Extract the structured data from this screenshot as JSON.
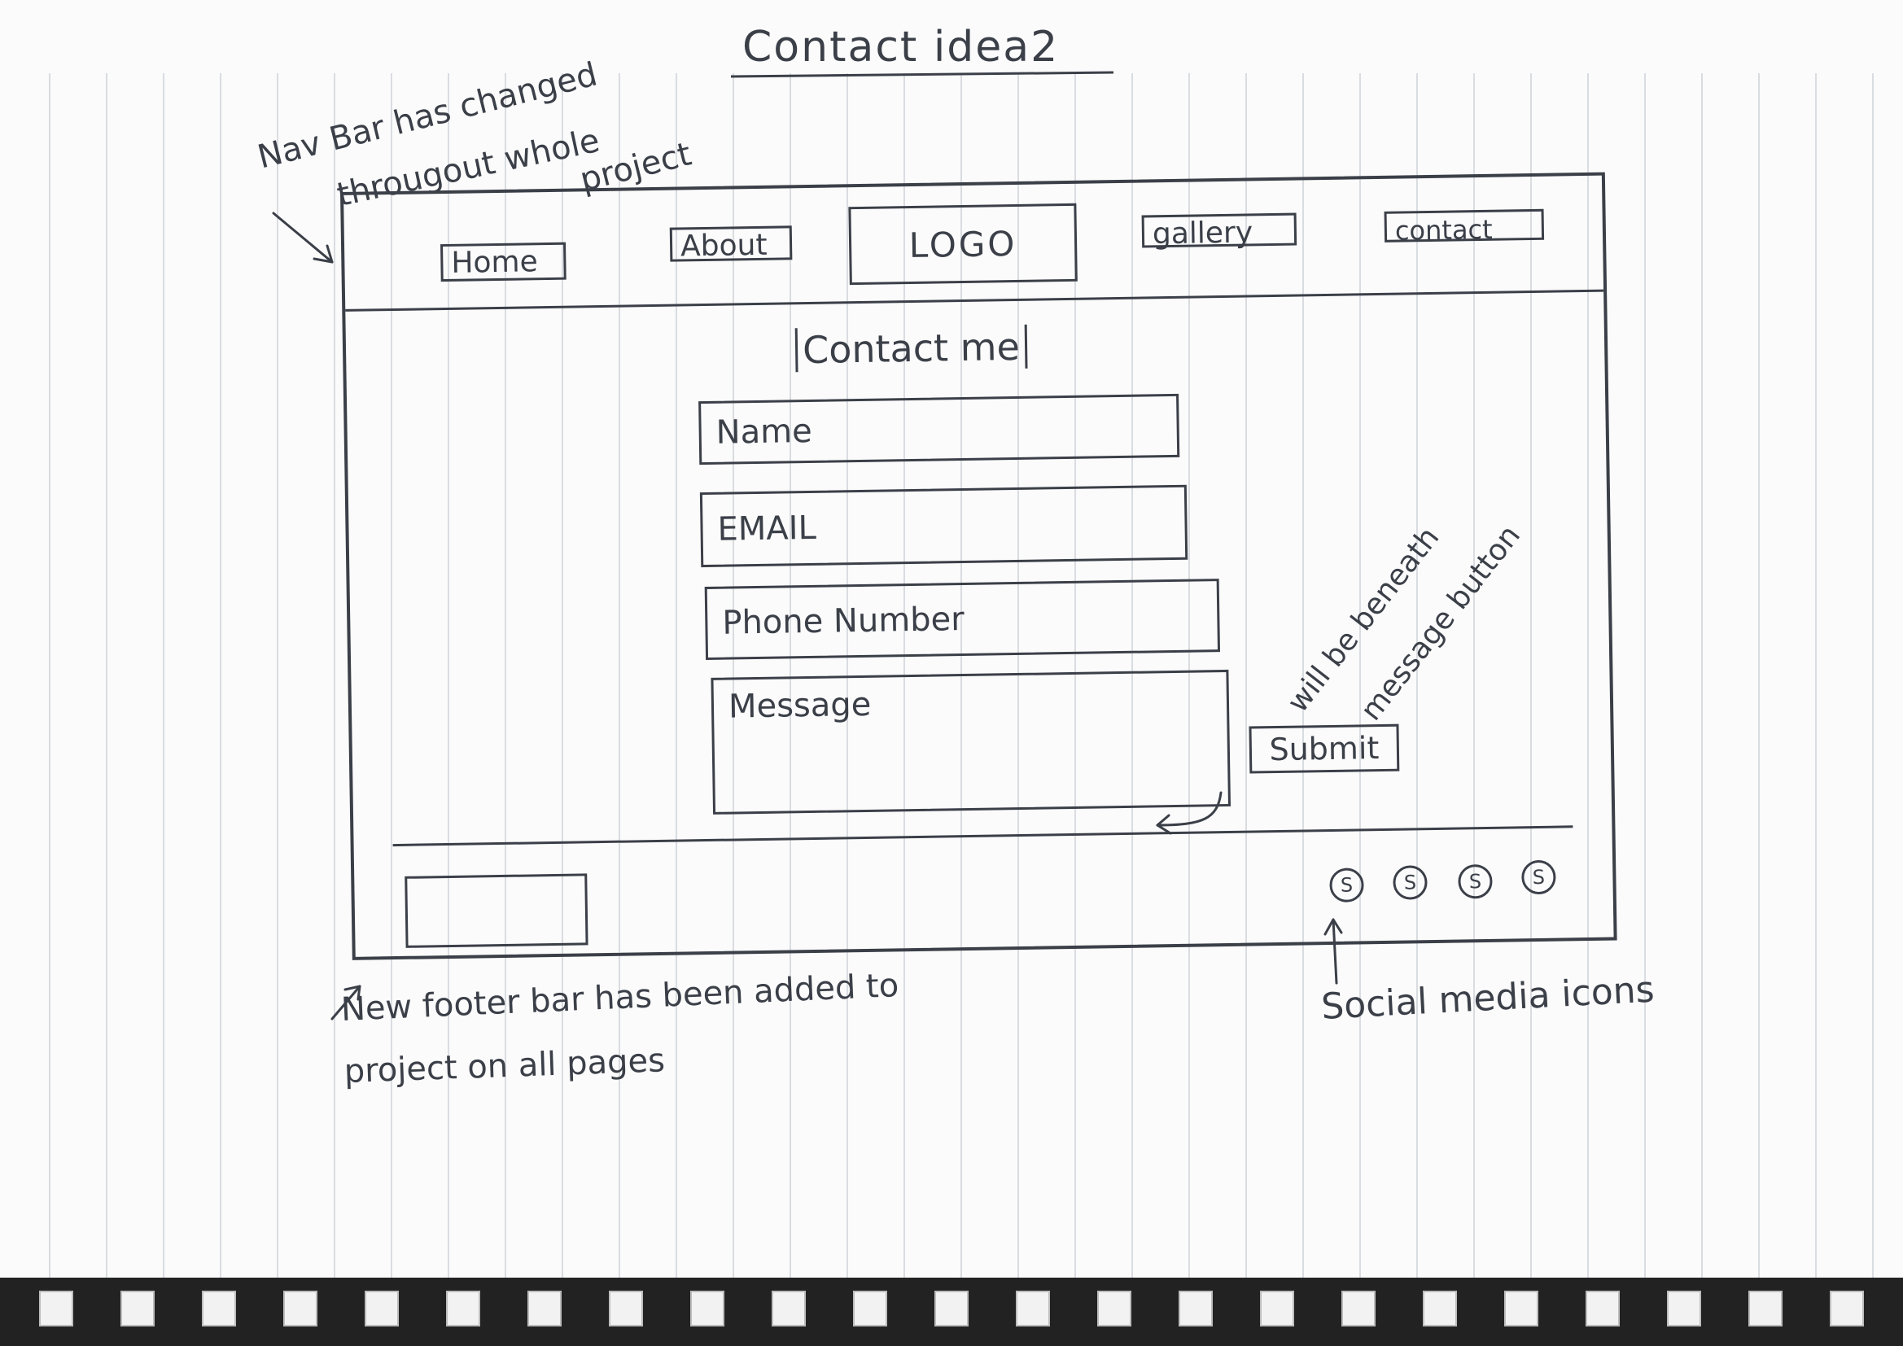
{
  "page_title": "Contact idea2",
  "nav": {
    "home": "Home",
    "about": "About",
    "logo": "LOGO",
    "gallery": "gallery",
    "contact": "contact"
  },
  "main": {
    "heading": "Contact me",
    "fields": {
      "name_placeholder": "Name",
      "email_placeholder": "EMAIL",
      "phone_placeholder": "Phone Number",
      "message_placeholder": "Message"
    },
    "submit_label": "Submit"
  },
  "footer": {
    "social_icons": [
      "S",
      "S",
      "S",
      "S"
    ]
  },
  "annotations": {
    "nav_note_line1": "Nav Bar has changed",
    "nav_note_line2": "througout whole",
    "nav_note_line3": "project",
    "beneath_note_line1": "will be beneath",
    "beneath_note_line2": "message button",
    "footer_note_line1": "New footer bar has been added to",
    "footer_note_line2": "project on all pages",
    "social_note": "Social media icons"
  },
  "icons": {
    "social": "circled-s-icon",
    "arrow": "arrow-icon"
  },
  "colors": {
    "ink": "#3b3f48",
    "paper": "#fbfbfb",
    "rule_lines": "#d9dce0"
  }
}
